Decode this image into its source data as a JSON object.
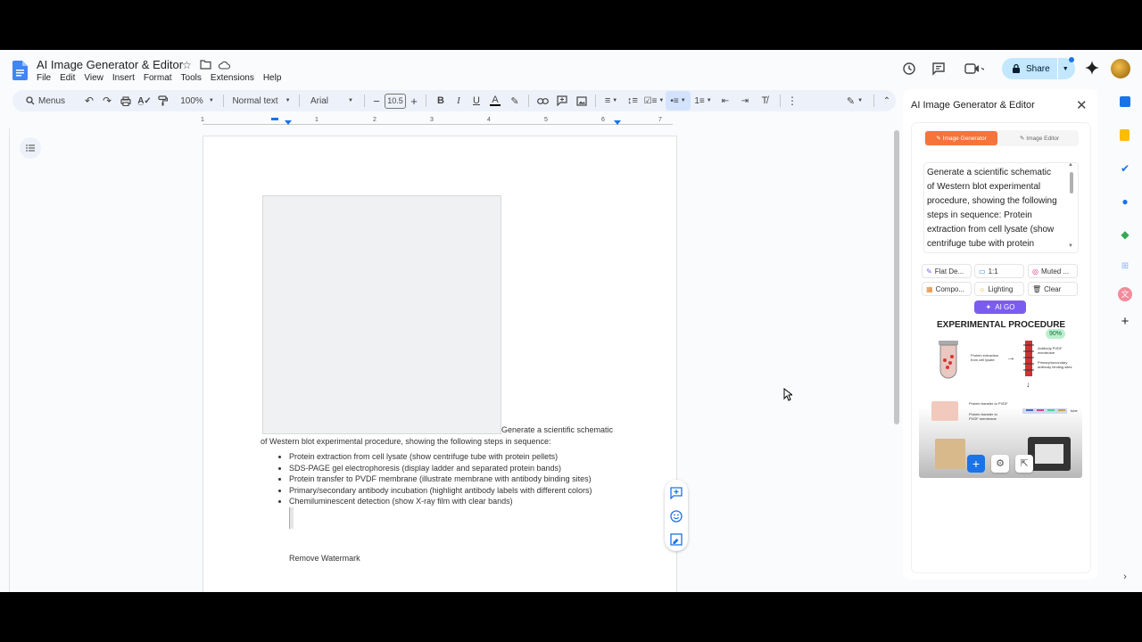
{
  "document": {
    "title": "AI Image Generator & Editor",
    "menu": [
      "File",
      "Edit",
      "View",
      "Insert",
      "Format",
      "Tools",
      "Extensions",
      "Help"
    ],
    "icons": [
      "docs-logo-icon",
      "star-icon",
      "folder-icon",
      "cloud-icon"
    ]
  },
  "header": {
    "share_label": "Share",
    "icons": [
      "history-icon",
      "comment-icon",
      "meet-icon",
      "gemini-icon",
      "avatar"
    ]
  },
  "toolbar": {
    "menus_label": "Menus",
    "zoom": "100%",
    "style": "Normal text",
    "font": "Arial",
    "font_size": "10.5"
  },
  "ruler": {
    "ticks": [
      "1",
      "1",
      "2",
      "3",
      "4",
      "5",
      "6",
      "7"
    ]
  },
  "body": {
    "line1": "Generate a scientific schematic",
    "line2": "of Western blot experimental procedure, showing the following steps in sequence:",
    "steps": [
      "Protein extraction from cell lysate (show centrifuge tube with protein pellets)",
      "SDS-PAGE gel electrophoresis (display ladder and separated protein bands)",
      "Protein transfer to PVDF membrane (illustrate membrane with antibody binding sites)",
      "Primary/secondary antibody incubation (highlight antibody labels with different colors)",
      "Chemiluminescent detection (show X-ray film with clear bands)"
    ],
    "watermark_link": "Remove Watermark"
  },
  "sidepanel": {
    "title": "AI Image Generator & Editor",
    "tab_generator": "Image Generator",
    "tab_editor": "Image Editor",
    "prompt": "Generate a scientific schematic of Western blot experimental procedure, showing the following steps in sequence: Protein extraction from cell lysate (show centrifuge tube with protein pellets)...",
    "options": [
      "Flat De...",
      "1:1",
      "Muted ...",
      "Compo...",
      "Lighting",
      "Clear"
    ],
    "go_label": "AI GO",
    "preview": {
      "heading": "EXPERIMENTAL PROCEDURE",
      "progress": "90%",
      "labels": [
        "Protein extraction from cell lysate",
        "Antibody PVDF membrane",
        "Primary/secondary antibody binding sites",
        "Protein transfer to PVDF",
        "Protein transfer to PVDF membrane",
        "tube"
      ]
    }
  },
  "colors": {
    "accent": "#1a73e8",
    "orange": "#f6733a",
    "purple": "#7b5cf0",
    "share_bg": "#c2e7ff"
  }
}
